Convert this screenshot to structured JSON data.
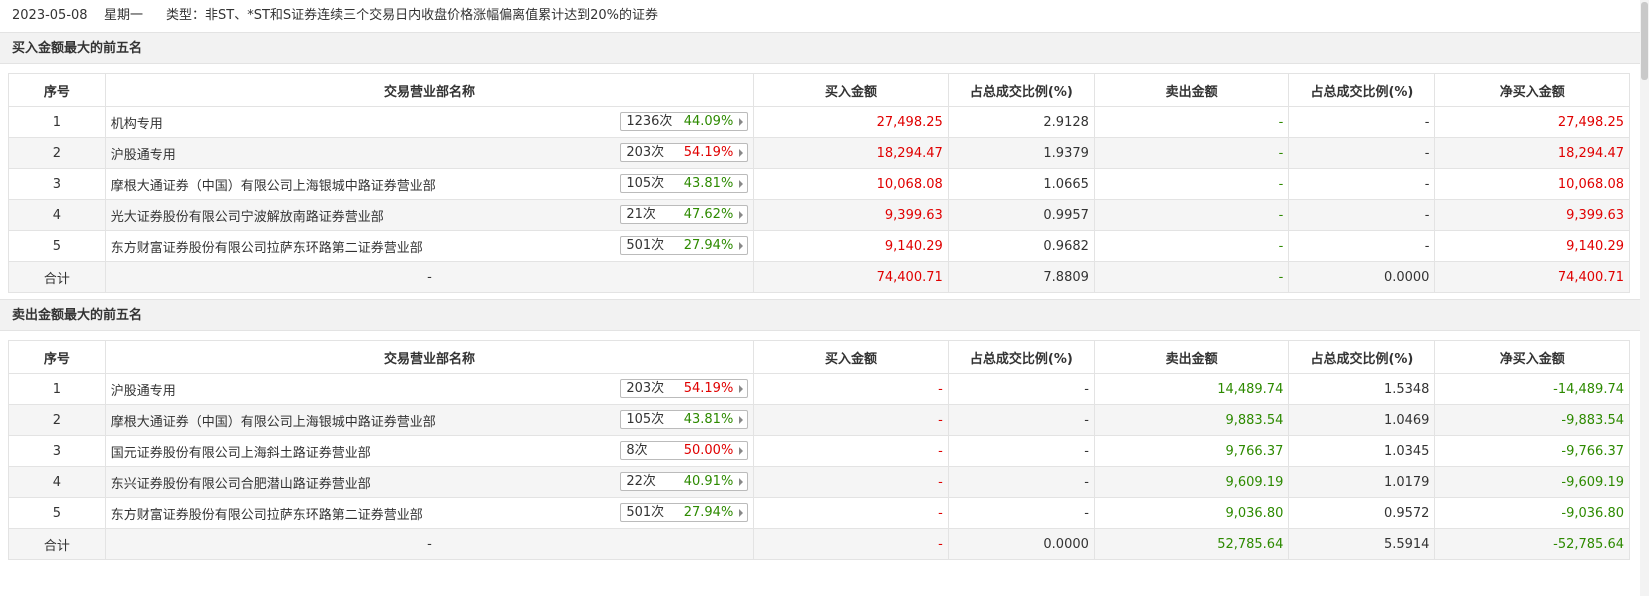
{
  "header": {
    "date": "2023-05-08",
    "weekday": "星期一",
    "type_text": "类型：非ST、*ST和S证券连续三个交易日内收盘价格涨幅偏离值累计达到20%的证券"
  },
  "columns": [
    "序号",
    "交易营业部名称",
    "买入金额",
    "占总成交比例(%)",
    "卖出金额",
    "占总成交比例(%)",
    "净买入金额"
  ],
  "colors": {
    "up": "#e00000",
    "down": "#2d8a00",
    "border": "#e3e3e3",
    "stripe": "#f5f5f5"
  },
  "buy_section": {
    "title": "买入金额最大的前五名",
    "rows": [
      {
        "no": "1",
        "name": "机构专用",
        "count": "1236次",
        "rate": "44.09%",
        "rate_color": "green",
        "buy": "27,498.25",
        "buy_pct": "2.9128",
        "sell": "-",
        "sell_pct": "-",
        "net": "27,498.25",
        "net_color": "red"
      },
      {
        "no": "2",
        "name": "沪股通专用",
        "count": "203次",
        "rate": "54.19%",
        "rate_color": "red",
        "buy": "18,294.47",
        "buy_pct": "1.9379",
        "sell": "-",
        "sell_pct": "-",
        "net": "18,294.47",
        "net_color": "red"
      },
      {
        "no": "3",
        "name": "摩根大通证券（中国）有限公司上海银城中路证券营业部",
        "count": "105次",
        "rate": "43.81%",
        "rate_color": "green",
        "buy": "10,068.08",
        "buy_pct": "1.0665",
        "sell": "-",
        "sell_pct": "-",
        "net": "10,068.08",
        "net_color": "red"
      },
      {
        "no": "4",
        "name": "光大证券股份有限公司宁波解放南路证券营业部",
        "count": "21次",
        "rate": "47.62%",
        "rate_color": "green",
        "buy": "9,399.63",
        "buy_pct": "0.9957",
        "sell": "-",
        "sell_pct": "-",
        "net": "9,399.63",
        "net_color": "red"
      },
      {
        "no": "5",
        "name": "东方财富证券股份有限公司拉萨东环路第二证券营业部",
        "count": "501次",
        "rate": "27.94%",
        "rate_color": "green",
        "buy": "9,140.29",
        "buy_pct": "0.9682",
        "sell": "-",
        "sell_pct": "-",
        "net": "9,140.29",
        "net_color": "red"
      }
    ],
    "total": {
      "label": "合计",
      "name": "-",
      "buy": "74,400.71",
      "buy_pct": "7.8809",
      "sell": "-",
      "sell_pct": "0.0000",
      "net": "74,400.71",
      "net_color": "red"
    }
  },
  "sell_section": {
    "title": "卖出金额最大的前五名",
    "rows": [
      {
        "no": "1",
        "name": "沪股通专用",
        "count": "203次",
        "rate": "54.19%",
        "rate_color": "red",
        "buy": "-",
        "buy_pct": "-",
        "sell": "14,489.74",
        "sell_pct": "1.5348",
        "net": "-14,489.74",
        "net_color": "green"
      },
      {
        "no": "2",
        "name": "摩根大通证券（中国）有限公司上海银城中路证券营业部",
        "count": "105次",
        "rate": "43.81%",
        "rate_color": "green",
        "buy": "-",
        "buy_pct": "-",
        "sell": "9,883.54",
        "sell_pct": "1.0469",
        "net": "-9,883.54",
        "net_color": "green"
      },
      {
        "no": "3",
        "name": "国元证券股份有限公司上海斜土路证券营业部",
        "count": "8次",
        "rate": "50.00%",
        "rate_color": "red",
        "buy": "-",
        "buy_pct": "-",
        "sell": "9,766.37",
        "sell_pct": "1.0345",
        "net": "-9,766.37",
        "net_color": "green"
      },
      {
        "no": "4",
        "name": "东兴证券股份有限公司合肥潜山路证券营业部",
        "count": "22次",
        "rate": "40.91%",
        "rate_color": "green",
        "buy": "-",
        "buy_pct": "-",
        "sell": "9,609.19",
        "sell_pct": "1.0179",
        "net": "-9,609.19",
        "net_color": "green"
      },
      {
        "no": "5",
        "name": "东方财富证券股份有限公司拉萨东环路第二证券营业部",
        "count": "501次",
        "rate": "27.94%",
        "rate_color": "green",
        "buy": "-",
        "buy_pct": "-",
        "sell": "9,036.80",
        "sell_pct": "0.9572",
        "net": "-9,036.80",
        "net_color": "green"
      }
    ],
    "total": {
      "label": "合计",
      "name": "-",
      "buy": "-",
      "buy_pct": "0.0000",
      "sell": "52,785.64",
      "sell_pct": "5.5914",
      "net": "-52,785.64",
      "net_color": "green"
    }
  }
}
